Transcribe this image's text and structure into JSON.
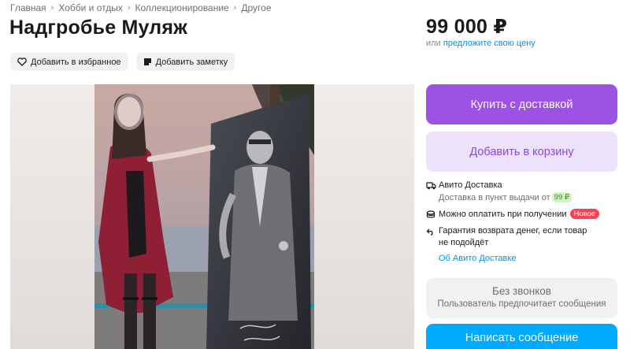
{
  "breadcrumbs": {
    "items": [
      "Главная",
      "Хобби и отдых",
      "Коллекционирование",
      "Другое"
    ],
    "separator": "›"
  },
  "listing": {
    "title": "Надгробье Муляж",
    "price": "99 000 ₽",
    "price_hint_prefix": "или",
    "price_hint_link": "предложите свою цену"
  },
  "actions": {
    "favorite_label": "Добавить в избранное",
    "note_label": "Добавить заметку"
  },
  "buttons": {
    "buy_label": "Купить с доставкой",
    "cart_label": "Добавить в корзину",
    "message_label": "Написать сообщение"
  },
  "delivery": {
    "title": "Авито Доставка",
    "pickup_text": "Доставка в пункт выдачи от",
    "pickup_price": "99 ₽",
    "pay_on_receipt": "Можно оплатить при получении",
    "new_badge": "Новое",
    "guarantee_line1": "Гарантия возврата денег, если товар",
    "guarantee_line2": "не подойдёт",
    "about_link": "Об Авито Доставке"
  },
  "contact": {
    "no_calls_title": "Без звонков",
    "no_calls_subtitle": "Пользователь предпочитает сообщения"
  },
  "icons": {
    "favorite": "heart-icon",
    "note": "note-icon",
    "delivery": "truck-icon",
    "payment": "coins-icon",
    "guarantee": "return-arrow-icon"
  },
  "colors": {
    "buy_button": "#9d52e6",
    "cart_button_bg": "#ede2fb",
    "cart_button_text": "#8f45dd",
    "message_button": "#00aaff",
    "link": "#0a8fd8",
    "badge_new": "#ff4053",
    "badge_price": "#d5f2c9"
  }
}
